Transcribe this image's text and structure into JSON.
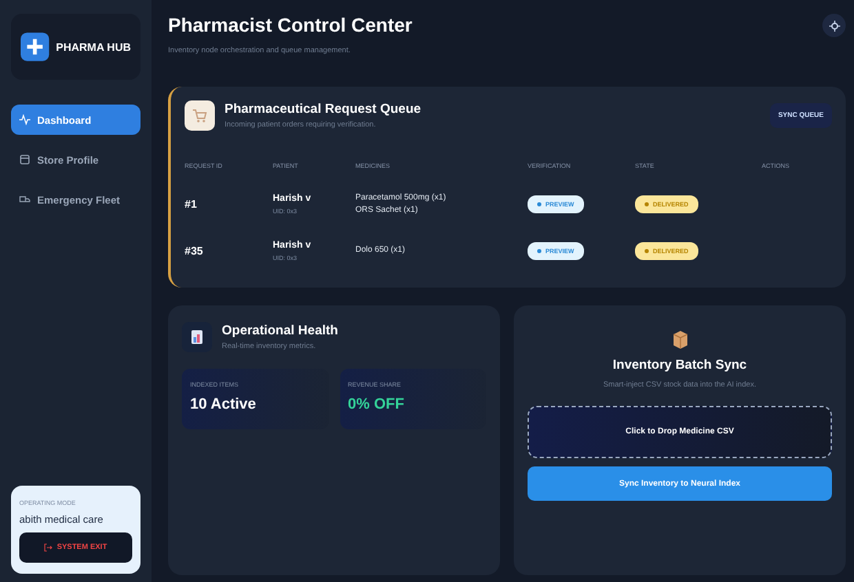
{
  "brand": {
    "name": "PHARMA HUB"
  },
  "nav": [
    {
      "label": "Dashboard",
      "kind": "pulse",
      "selected": true
    },
    {
      "label": "Store Profile",
      "kind": "store",
      "selected": false
    },
    {
      "label": "Emergency Fleet",
      "kind": "truck",
      "selected": false
    }
  ],
  "mode_card": {
    "label": "OPERATING MODE",
    "name": "abith medical care",
    "exit": "SYSTEM EXIT"
  },
  "header": {
    "title": "Pharmacist Control Center",
    "subtitle": "Inventory node orchestration and queue management."
  },
  "queue": {
    "title": "Pharmaceutical Request Queue",
    "subtitle": "Incoming patient orders requiring verification.",
    "action": "SYNC QUEUE",
    "columns": [
      "REQUEST ID",
      "PATIENT",
      "MEDICINES",
      "VERIFICATION",
      "STATE",
      "ACTIONS"
    ],
    "rows": [
      {
        "id": "#1",
        "patient": "Harish v",
        "uid": "UID: 0x3",
        "medicines": [
          "Paracetamol 500mg (x1)",
          "ORS Sachet (x1)"
        ],
        "verification": "PREVIEW",
        "state": "DELIVERED"
      },
      {
        "id": "#35",
        "patient": "Harish v",
        "uid": "UID: 0x3",
        "medicines": [
          "Dolo 650 (x1)"
        ],
        "verification": "PREVIEW",
        "state": "DELIVERED"
      }
    ]
  },
  "health": {
    "title": "Operational Health",
    "subtitle": "Real-time inventory metrics.",
    "metrics": [
      {
        "label": "INDEXED ITEMS",
        "value": "10 Active",
        "color": "#ffffff"
      },
      {
        "label": "REVENUE SHARE",
        "value": "0% OFF",
        "color": "#34d399"
      }
    ]
  },
  "batch": {
    "title": "Inventory Batch Sync",
    "subtitle": "Smart-inject CSV stock data into the AI index.",
    "drop": "Click to Drop Medicine CSV",
    "button": "Sync Inventory to Neural Index"
  }
}
